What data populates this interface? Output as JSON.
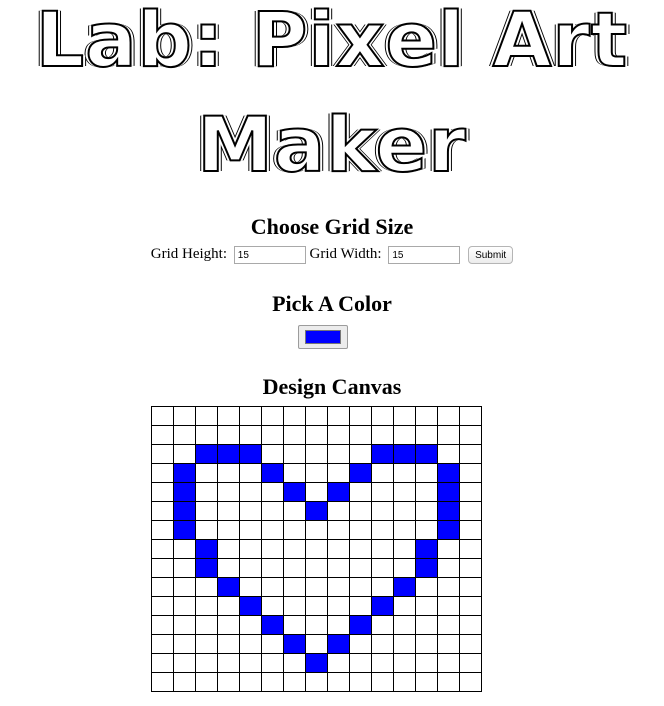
{
  "title": {
    "line1": "Lab: Pixel Art",
    "line2": "Maker"
  },
  "grid_section": {
    "heading": "Choose Grid Size",
    "height_label": "Grid Height:",
    "height_value": "15",
    "width_label": "Grid Width:",
    "width_value": "15",
    "submit_label": "Submit"
  },
  "color_section": {
    "heading": "Pick A Color",
    "selected_color": "#0000ff"
  },
  "canvas_section": {
    "heading": "Design Canvas",
    "rows": 15,
    "cols": 15,
    "fill_color": "#0000ff",
    "filled_cells": [
      [
        2,
        2
      ],
      [
        2,
        3
      ],
      [
        2,
        4
      ],
      [
        2,
        10
      ],
      [
        2,
        11
      ],
      [
        2,
        12
      ],
      [
        3,
        1
      ],
      [
        3,
        5
      ],
      [
        3,
        9
      ],
      [
        3,
        13
      ],
      [
        4,
        1
      ],
      [
        4,
        6
      ],
      [
        4,
        8
      ],
      [
        4,
        13
      ],
      [
        5,
        1
      ],
      [
        5,
        7
      ],
      [
        5,
        13
      ],
      [
        6,
        1
      ],
      [
        6,
        13
      ],
      [
        7,
        2
      ],
      [
        7,
        12
      ],
      [
        8,
        2
      ],
      [
        8,
        12
      ],
      [
        9,
        3
      ],
      [
        9,
        11
      ],
      [
        10,
        4
      ],
      [
        10,
        10
      ],
      [
        11,
        5
      ],
      [
        11,
        9
      ],
      [
        12,
        6
      ],
      [
        12,
        8
      ],
      [
        13,
        7
      ]
    ]
  }
}
